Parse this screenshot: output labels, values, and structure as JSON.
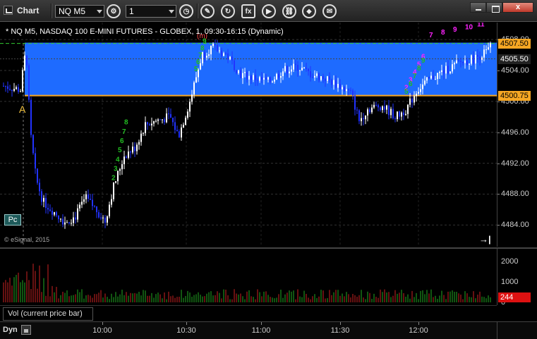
{
  "window": {
    "title": "Chart",
    "close_label": "x"
  },
  "toolbar": {
    "symbol": "NQ M5",
    "interval": "1",
    "icons": [
      "settings-icon",
      "clock-icon",
      "pencil-icon",
      "refresh-icon",
      "studies-icon",
      "play-icon",
      "link-icon",
      "tag-icon",
      "chat-icon"
    ],
    "studies_label": "fx"
  },
  "chart_title": "* NQ M5, NASDAQ 100 E-MINI FUTURES - GLOBEX, 1, 09:30-16:15 (Dynamic)",
  "copyright": "© eSignal, 2015",
  "pc_button": "Pc",
  "scroll_end_icon": "scroll-to-end-icon",
  "marker_a": "A",
  "marker_m": "(m)",
  "price_axis": {
    "labels": [
      "4508.00",
      "4504.00",
      "4500.00",
      "4496.00",
      "4492.00",
      "4488.00",
      "4484.00"
    ],
    "values": [
      4508,
      4504,
      4500,
      4496,
      4492,
      4488,
      4484
    ],
    "last_price": "4507.50",
    "mid_price": "4505.50",
    "low_zone": "4500.75",
    "range": [
      4481.2,
      4510.2
    ],
    "colors": {
      "last_price_bg": "#f5a623",
      "low_zone_bg": "#f5a623",
      "mid_price_bg": "#222"
    }
  },
  "zone": {
    "top": 4507.6,
    "bottom": 4500.75,
    "color": "#1e6bff"
  },
  "green_line": 4507.5,
  "volume": {
    "legend": "Vol (current price bar)",
    "axis_labels": [
      "2000",
      "1000",
      "0"
    ],
    "axis_values": [
      2000,
      1000,
      0
    ],
    "current": "244",
    "max": 2500
  },
  "time_axis": {
    "labels": [
      "10:00",
      "10:30",
      "11:00",
      "11:30",
      "12:00"
    ]
  },
  "dyn_label": "Dyn",
  "td_counts": {
    "green_early": [
      "8",
      "7",
      "6",
      "5",
      "4",
      "3",
      "2"
    ],
    "green_top": [
      "9",
      "8",
      "7",
      "6",
      "5"
    ],
    "magenta_top": [
      "7",
      "8",
      "9",
      "10",
      "11"
    ],
    "magenta_mid": [
      "6",
      "5",
      "4",
      "3",
      "2"
    ],
    "green_late": [
      "9",
      "8",
      "7",
      "6",
      "5"
    ]
  },
  "colors": {
    "up": "#ffffff",
    "down": "#2233ff",
    "td_green": "#22bb22",
    "td_magenta": "#ff22ff",
    "vol_up": "#22aa22",
    "vol_down": "#cc2222"
  }
}
